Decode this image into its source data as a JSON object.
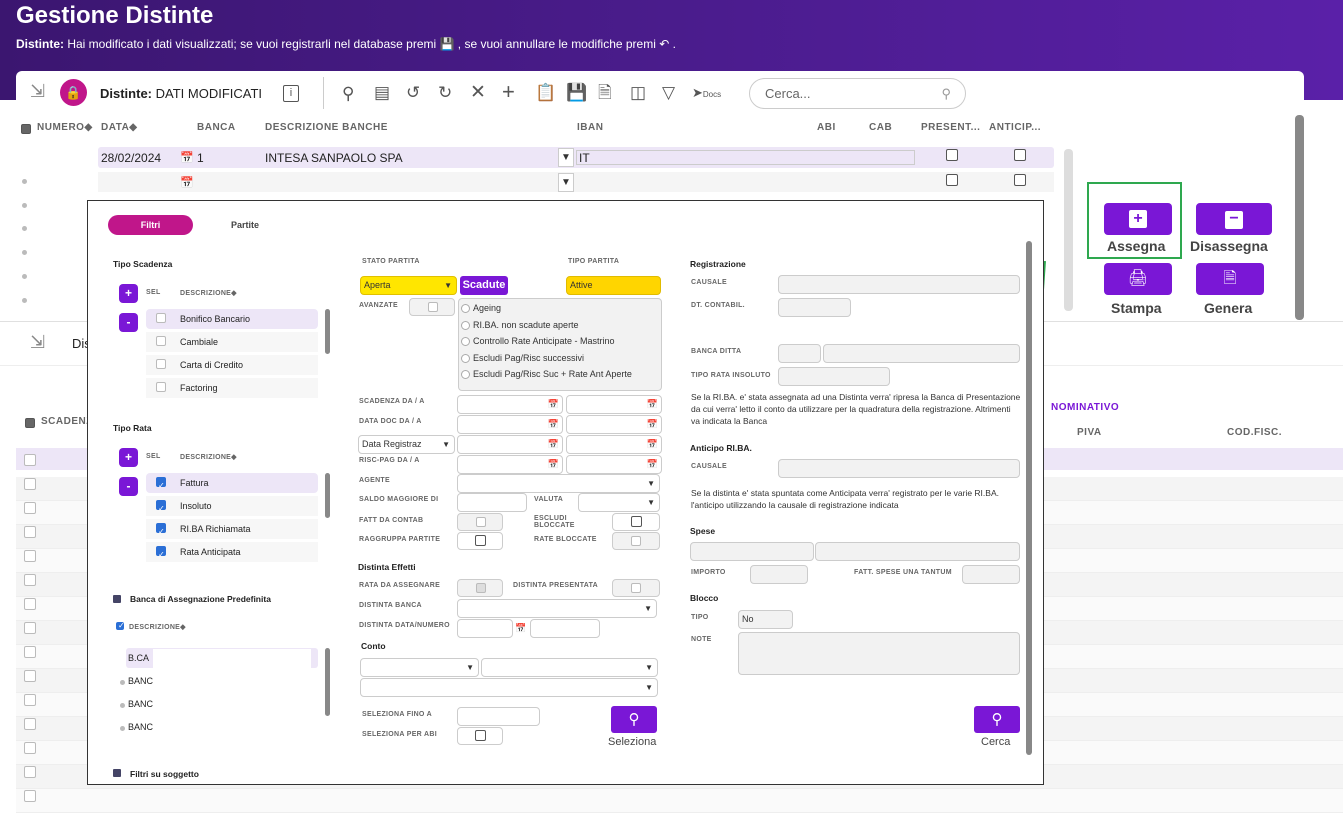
{
  "header": {
    "title": "Gestione Distinte",
    "notice_bold": "Distinte:",
    "notice_text_1": " Hai modificato i dati visualizzati; se vuoi registrarli nel database premi ",
    "notice_text_2": " , se vuoi annullare le modifiche premi ",
    "notice_text_3": " ."
  },
  "toolbar": {
    "label_bold": "Distinte:",
    "label_status": "DATI MODIFICATI",
    "search_placeholder": "Cerca...",
    "docs_label": "Docs"
  },
  "grid": {
    "columns": [
      "NUMERO",
      "DATA",
      "BANCA",
      "DESCRIZIONE BANCHE",
      "IBAN",
      "ABI",
      "CAB",
      "PRESENT...",
      "ANTICIP..."
    ],
    "rows": [
      {
        "data": "28/02/2024",
        "banca": "1",
        "descrizione": "INTESA SANPAOLO SPA",
        "iban": "IT"
      }
    ]
  },
  "actions": {
    "assegna": "Assegna",
    "disassegna": "Disassegna",
    "stampa": "Stampa",
    "genera": "Genera"
  },
  "lower_grid": {
    "toolbar_label": "Dis",
    "columns": {
      "scadenza": "SCADENZ",
      "nominativo": "NOMINATIVO",
      "piva": "PIVA",
      "codfisc": "COD.FISC."
    }
  },
  "modal": {
    "tabs": {
      "filtri": "Filtri",
      "partite": "Partite"
    },
    "tipo_scadenza": {
      "title": "Tipo Scadenza",
      "sel": "SEL",
      "descr": "DESCRIZIONE",
      "items": [
        "Bonifico Bancario",
        "Cambiale",
        "Carta di Credito",
        "Factoring"
      ]
    },
    "tipo_rata": {
      "title": "Tipo Rata",
      "sel": "SEL",
      "descr": "DESCRIZIONE",
      "items": [
        "Fattura",
        "Insoluto",
        "RI.BA Richiamata",
        "Rata Anticipata"
      ]
    },
    "banca_predef": {
      "title": "Banca di Assegnazione Predefinita",
      "descr": "DESCRIZIONE",
      "items": [
        "B.CA",
        "BANC",
        "BANC",
        "BANC"
      ]
    },
    "filtri_soggetto": "Filtri su soggetto",
    "stato_partita": {
      "label": "STATO PARTITA",
      "value": "Aperta",
      "btn": "Scadute"
    },
    "tipo_partita": {
      "label": "TIPO PARTITA",
      "value": "Attive"
    },
    "avanzate": "AVANZATE",
    "radio_options": [
      "Ageing",
      "RI.BA. non scadute aperte",
      "Controllo Rate Anticipate - Mastrino",
      "Escludi Pag/Risc successivi",
      "Escludi Pag/Risc Suc + Rate Ant Aperte"
    ],
    "labels": {
      "scadenza": "SCADENZA DA / A",
      "datadoc": "DATA DOC DA / A",
      "data_reg": "Data Registraz",
      "riscpag": "RISC-PAG DA / A",
      "agente": "AGENTE",
      "saldo": "SALDO MAGGIORE DI",
      "valuta": "VALUTA",
      "fatt_contab": "FATT DA CONTAB",
      "escludi_bloccate": "ESCLUDI BLOCCATE",
      "raggruppa": "RAGGRUPPA PARTITE",
      "rate_bloccate": "RATE BLOCCATE",
      "distinta_effetti": "Distinta Effetti",
      "rata_assegnare": "RATA DA ASSEGNARE",
      "distinta_presentata": "DISTINTA PRESENTATA",
      "distinta_banca": "DISTINTA BANCA",
      "distinta_data": "DISTINTA DATA/NUMERO",
      "conto": "Conto",
      "seleziona_fino": "SELEZIONA FINO A",
      "seleziona_abi": "SELEZIONA PER ABI",
      "seleziona_btn": "Seleziona"
    },
    "right": {
      "registrazione": "Registrazione",
      "causale": "CAUSALE",
      "dt_contabil": "DT. CONTABIL.",
      "banca_ditta": "BANCA DITTA",
      "tipo_rata_insoluto": "TIPO RATA INSOLUTO",
      "note1": "Se la RI.BA. e' stata assegnata ad una Distinta verra' ripresa la Banca di Presentazione da cui verra' letto il conto da utilizzare per la quadratura della registrazione. Altrimenti va indicata la Banca",
      "anticipo_riba": "Anticipo RI.BA.",
      "causale2": "CAUSALE",
      "note2": "Se la distinta e' stata spuntata come Anticipata verra' registrato per le varie RI.BA. l'anticipo utilizzando la causale di registrazione indicata",
      "spese": "Spese",
      "importo": "IMPORTO",
      "fatt_spese": "FATT. SPESE UNA TANTUM",
      "blocco": "Blocco",
      "tipo": "TIPO",
      "tipo_value": "No",
      "note": "NOTE",
      "cerca_btn": "Cerca"
    }
  }
}
